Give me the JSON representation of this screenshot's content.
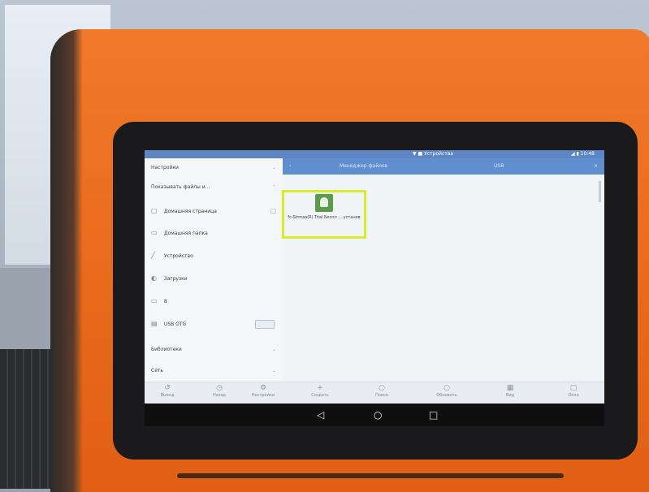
{
  "statusbar": {
    "center": "▼ ■ Устройства",
    "right": "◢ ▮ 10:48"
  },
  "drawer": {
    "items": [
      {
        "label": "Настройки",
        "icon": "",
        "trailing": "chevron"
      },
      {
        "label": "Показывать файлы и...",
        "icon": "",
        "trailing": "chevron"
      },
      {
        "label": "Домашняя страница",
        "icon": "home-icon",
        "trailing": "button"
      },
      {
        "label": "Домашняя папка",
        "icon": "folder-icon",
        "trailing": ""
      },
      {
        "label": "Устройство",
        "icon": "device-icon",
        "trailing": ""
      },
      {
        "label": "Загрузки",
        "icon": "download-icon",
        "trailing": ""
      },
      {
        "label": "8",
        "icon": "storage-icon",
        "trailing": ""
      },
      {
        "label": "USB OTG",
        "icon": "usb-icon",
        "trailing": "box"
      },
      {
        "label": "Библиотеки",
        "icon": "",
        "trailing": "chevron"
      },
      {
        "label": "Сеть",
        "icon": "",
        "trailing": "chevron"
      }
    ]
  },
  "toolbar": {
    "title": "Менеджер файлов",
    "path": "USB"
  },
  "file": {
    "name": "fc-Sirmaa(R) Trial Беспл ... установ"
  },
  "bottombar": {
    "items": [
      "Выход",
      "Назад",
      "Настройки",
      "Создать",
      "Поиск",
      "Обновить",
      "Вид",
      "Окна"
    ]
  },
  "navbar": {
    "back": "◁",
    "home": "○",
    "recents": "□"
  }
}
